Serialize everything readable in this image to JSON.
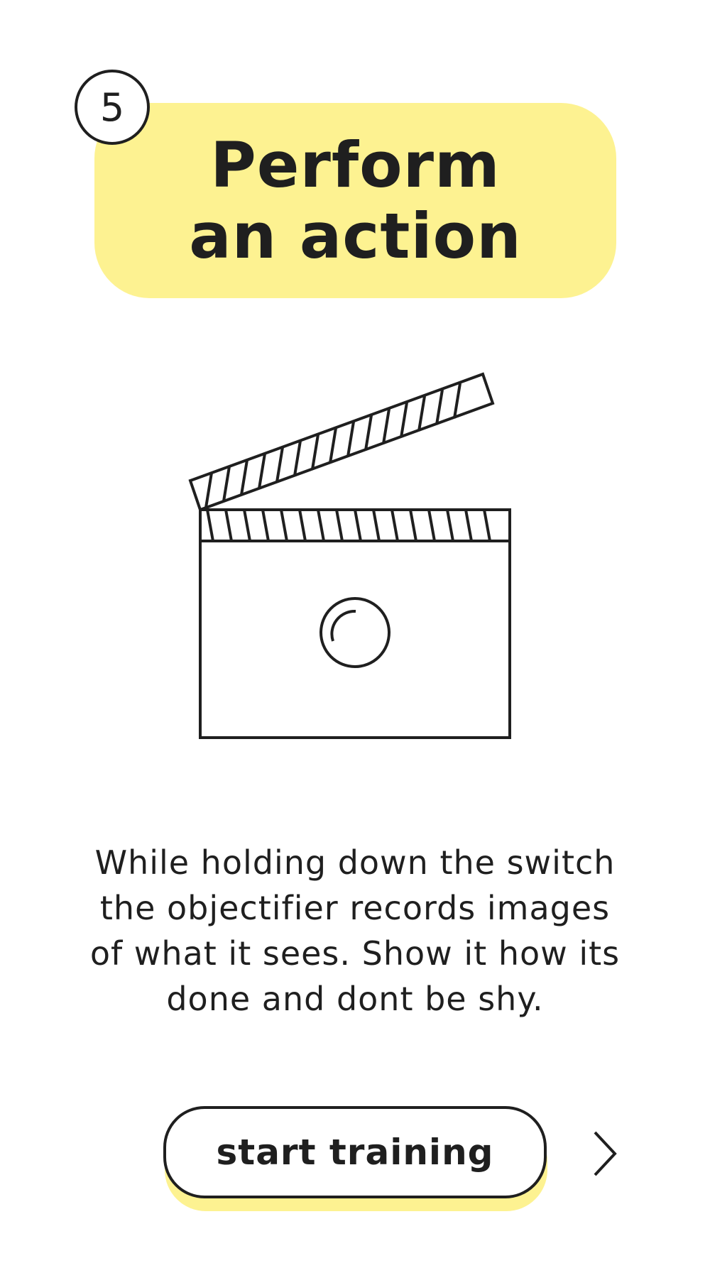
{
  "step": {
    "number": "5",
    "title_line1": "Perform",
    "title_line2": "an action"
  },
  "illustration": {
    "icon": "clapperboard-icon"
  },
  "description": {
    "line1": "While holding down the switch",
    "line2": "the objectifier records images",
    "line3": "of what it sees. Show it how its",
    "line4": "done and dont be shy."
  },
  "actions": {
    "start_label": "start training",
    "next_icon": "chevron-right-icon"
  },
  "colors": {
    "accent": "#fdf291",
    "ink": "#1f1f1f",
    "background": "#ffffff"
  }
}
